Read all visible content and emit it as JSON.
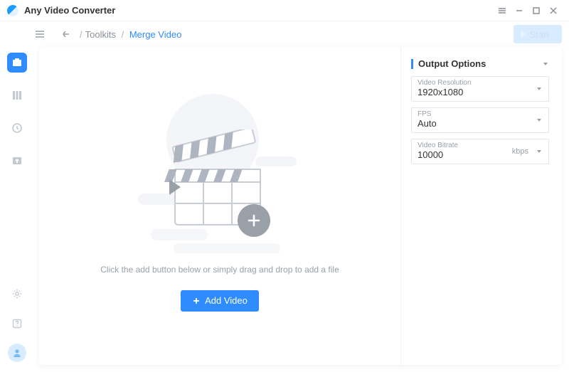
{
  "app": {
    "title": "Any Video Converter"
  },
  "breadcrumb": {
    "toolkits": "Toolkits",
    "current": "Merge Video"
  },
  "start_label": "Start",
  "hint": "Click the add button below or simply drag and drop to add a file",
  "add_label": "Add Video",
  "options": {
    "title": "Output Options",
    "resolution_label": "Video Resolution",
    "resolution_value": "1920x1080",
    "fps_label": "FPS",
    "fps_value": "Auto",
    "bitrate_label": "Video Bitrate",
    "bitrate_value": "10000",
    "bitrate_unit": "kbps"
  }
}
